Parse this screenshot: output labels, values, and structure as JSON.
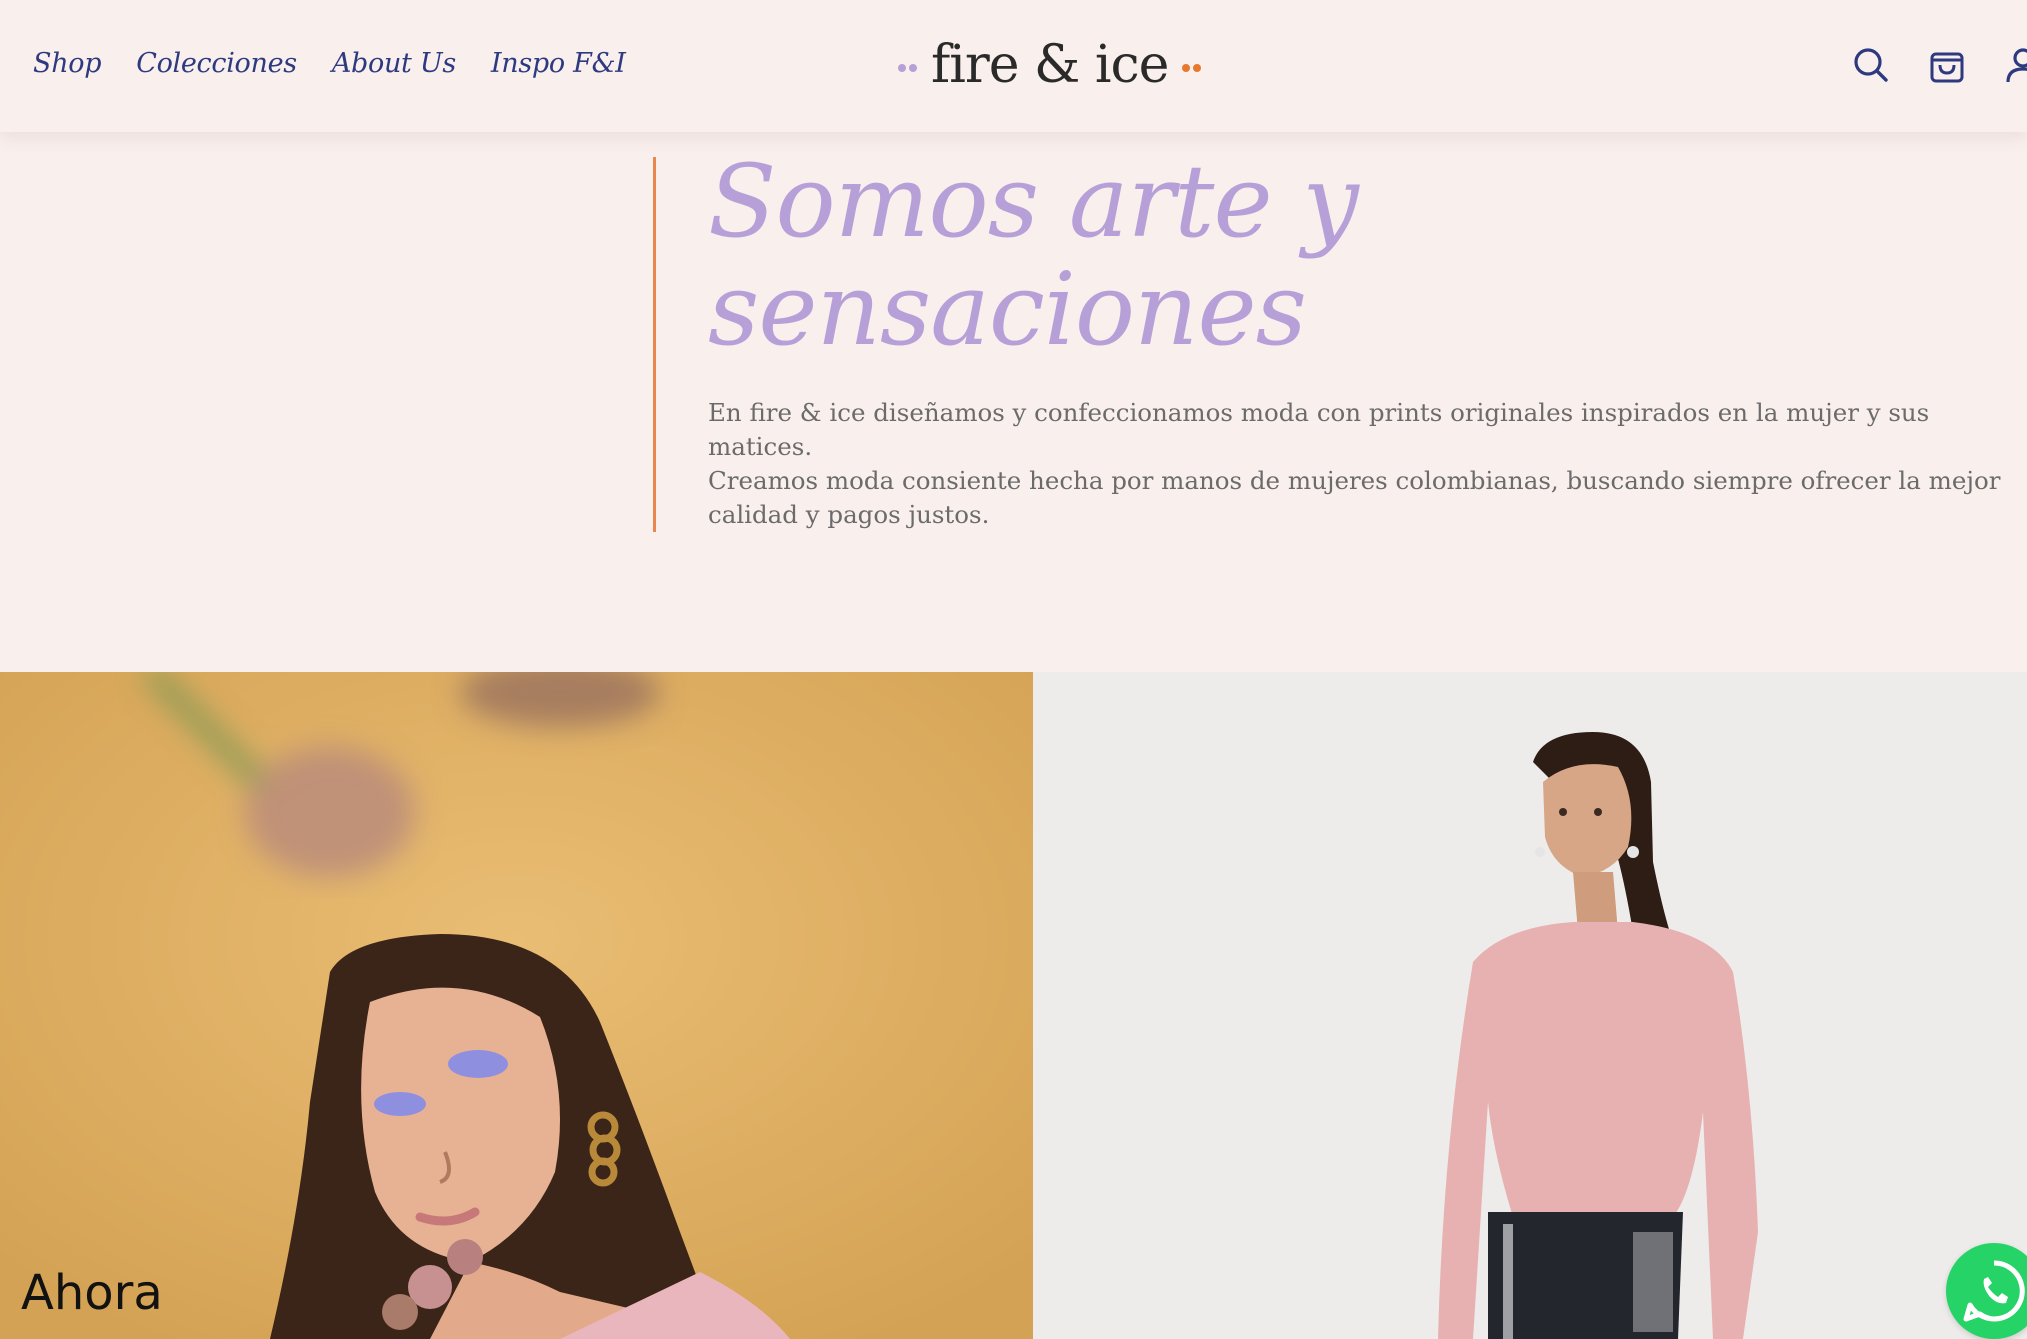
{
  "header": {
    "nav": [
      {
        "label": "Shop"
      },
      {
        "label": "Colecciones"
      },
      {
        "label": "About Us"
      },
      {
        "label": "Inspo F&I"
      }
    ],
    "logo": {
      "text": "fire & ice",
      "dots_left_color": "#b7a0d8",
      "dots_right_color": "#e8782e"
    },
    "icons": [
      "search-icon",
      "cart-icon",
      "account-icon"
    ]
  },
  "hero": {
    "title": "Somos arte y sensaciones",
    "body": "En fire & ice diseñamos y confeccionamos moda con prints originales inspirados en la mujer y sus matices.\nCreamos moda consiente hecha por manos de mujeres colombianas, buscando siempre ofrecer la mejor calidad y pagos justos."
  },
  "panels": {
    "left_caption": "Ahora"
  },
  "colors": {
    "background": "#f9efec",
    "nav": "#2e3a80",
    "title": "#b7a0d8",
    "accent_rule": "#e8884e",
    "whatsapp": "#25d366"
  }
}
